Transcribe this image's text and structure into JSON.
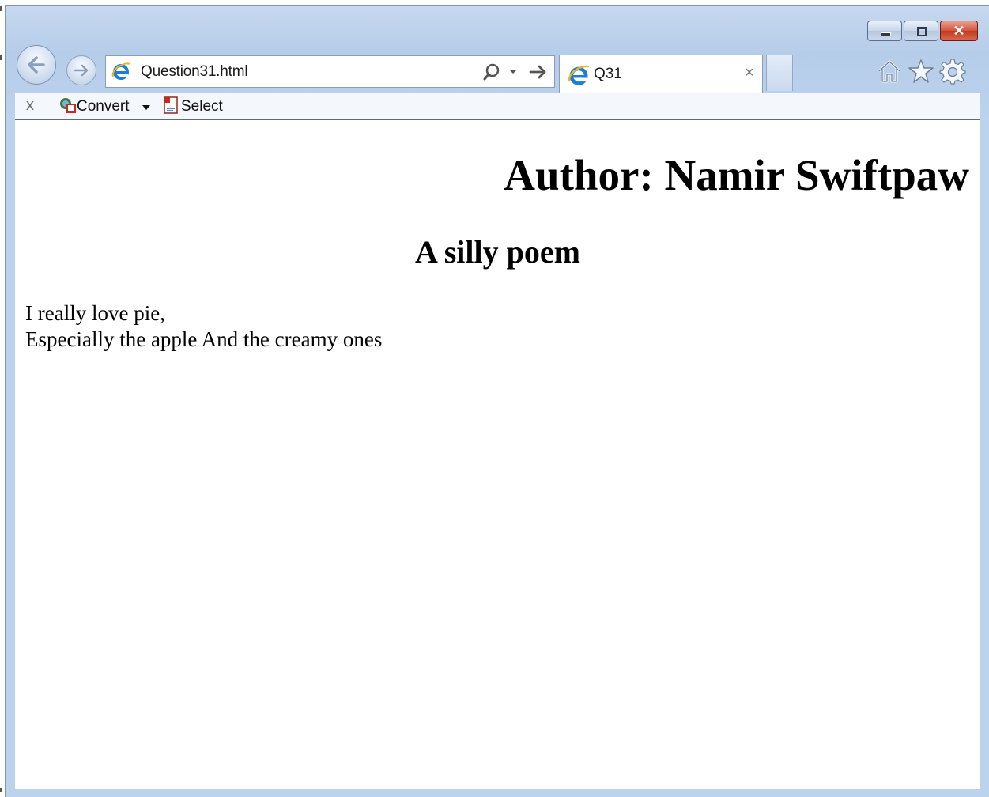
{
  "browser": {
    "address": "Question31.html",
    "tab_title": "Q31",
    "tab_close": "×",
    "close_glyph": "✕"
  },
  "command_bar": {
    "close_label": "x",
    "convert_label": "Convert",
    "select_label": "Select"
  },
  "page": {
    "author_heading": "Author: Namir Swiftpaw",
    "poem_title": "A silly poem",
    "poem_lines": [
      "I really love pie,",
      "Especially the apple And the creamy ones"
    ]
  },
  "icons": {
    "back": "back-arrow-icon",
    "forward": "forward-arrow-icon",
    "home": "home-icon",
    "favorites": "star-icon",
    "tools": "gear-icon",
    "search": "search-icon",
    "go": "go-arrow-icon",
    "page_icon": "ie-logo-icon"
  },
  "colors": {
    "frame": "#bcd3ee",
    "close_button": "#c13a20",
    "ie_blue": "#1d7fd1"
  }
}
